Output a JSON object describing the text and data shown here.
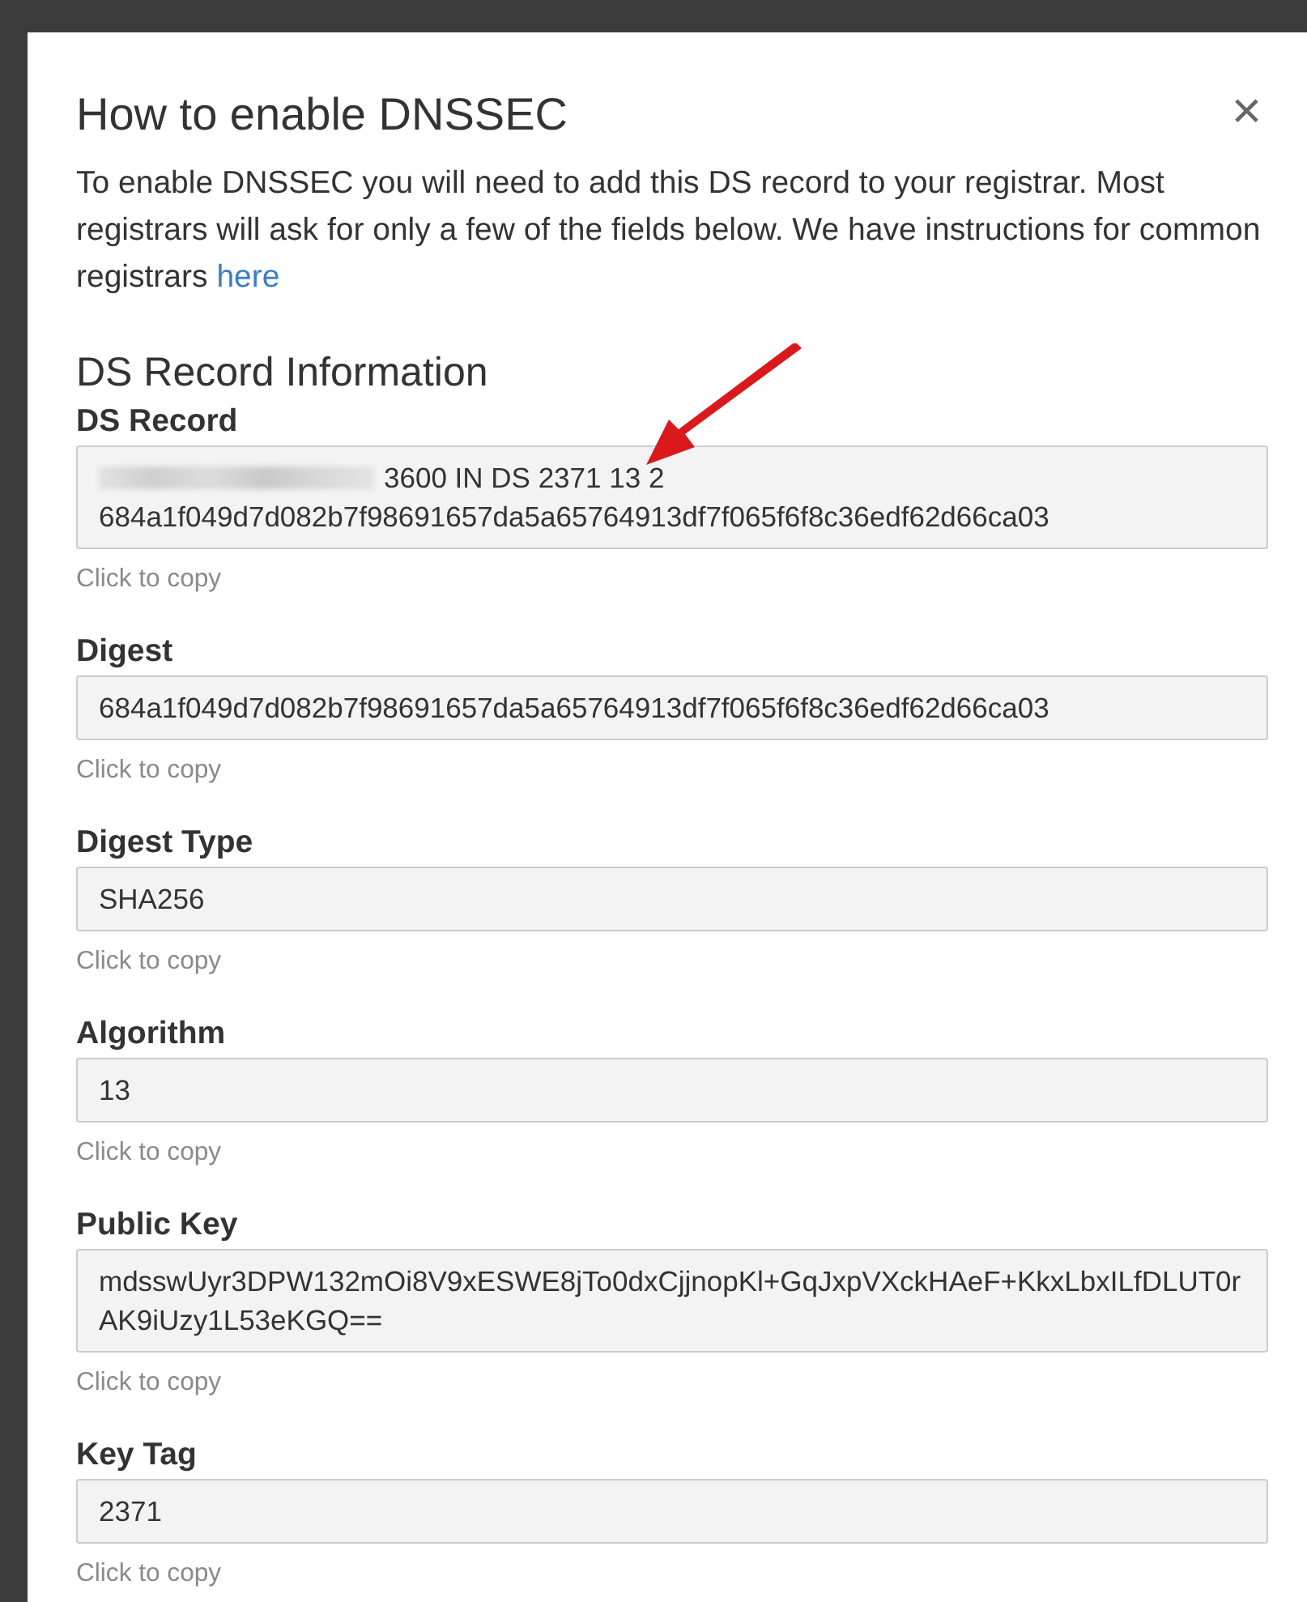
{
  "dialog": {
    "title": "How to enable DNSSEC",
    "close": "×",
    "intro": "To enable DNSSEC you will need to add this DS record to your registrar. Most registrars will ask for only a few of the fields below. We have instructions for common registrars",
    "intro_link": "here",
    "section_title": "DS Record Information",
    "fields": [
      {
        "label": "DS Record",
        "redacted": true,
        "value": "3600 IN DS 2371 13 2 684a1f049d7d082b7f98691657da5a65764913df7f065f6f8c36edf62d66ca03",
        "hint": "Click to copy"
      },
      {
        "label": "Digest",
        "redacted": false,
        "value": "684a1f049d7d082b7f98691657da5a65764913df7f065f6f8c36edf62d66ca03",
        "hint": "Click to copy"
      },
      {
        "label": "Digest Type",
        "redacted": false,
        "value": "SHA256",
        "hint": "Click to copy"
      },
      {
        "label": "Algorithm",
        "redacted": false,
        "value": "13",
        "hint": "Click to copy"
      },
      {
        "label": "Public Key",
        "redacted": false,
        "value": "mdsswUyr3DPW132mOi8V9xESWE8jTo0dxCjjnopKl+GqJxpVXckHAeF+KkxLbxILfDLUT0rAK9iUzy1L53eKGQ==",
        "hint": "Click to copy"
      },
      {
        "label": "Key Tag",
        "redacted": false,
        "value": "2371",
        "hint": "Click to copy"
      }
    ]
  }
}
